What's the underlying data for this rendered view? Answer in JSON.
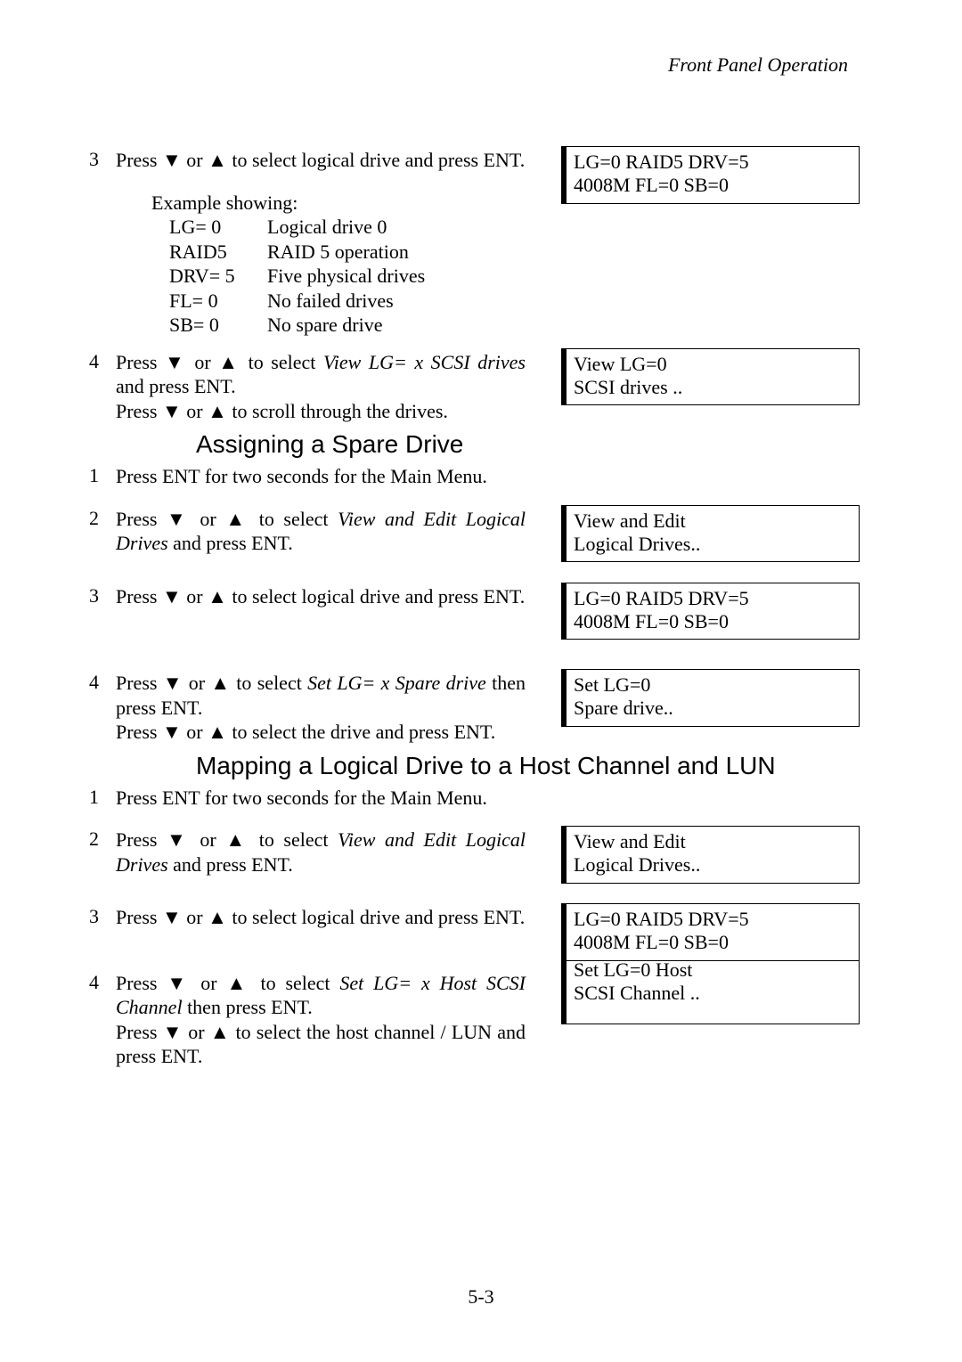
{
  "header": {
    "running": "Front Panel Operation"
  },
  "glyph": {
    "down": "▼",
    "up": "▲"
  },
  "sec1": {
    "step3": {
      "num": "3",
      "text_a": "Press ",
      "text_b": " or ",
      "text_c": " to select logical drive and press ENT.",
      "lcd": "LG=0 RAID5 DRV=5\n4008M FL=0 SB=0",
      "example_label": "Example showing:",
      "rows": [
        {
          "k": "LG= 0",
          "v": "Logical drive 0"
        },
        {
          "k": "RAID5",
          "v": "RAID 5 operation"
        },
        {
          "k": "DRV= 5",
          "v": "Five physical drives"
        },
        {
          "k": "FL= 0",
          "v": "No failed drives"
        },
        {
          "k": "SB= 0",
          "v": "No spare drive"
        }
      ]
    },
    "step4": {
      "num": "4",
      "text_a": "Press ",
      "text_b": " or ",
      "text_c": " to select ",
      "italic": "View LG= x SCSI drives",
      "text_d": " and press ENT.",
      "line2_a": "Press ",
      "line2_b": " or ",
      "line2_c": " to scroll through the drives.",
      "lcd": "View LG=0\nSCSI drives   .."
    }
  },
  "sec2": {
    "heading": "Assigning a Spare Drive",
    "step1": {
      "num": "1",
      "text": "Press ENT for two seconds for the Main Menu."
    },
    "step2": {
      "num": "2",
      "text_a": "Press ",
      "text_b": " or ",
      "text_c": " to select ",
      "italic": "View and Edit Logical Drives",
      "text_d": " and press ENT.",
      "lcd": "View and Edit\nLogical Drives.."
    },
    "step3": {
      "num": "3",
      "text_a": "Press ",
      "text_b": " or ",
      "text_c": " to select logical drive and press ENT.",
      "lcd": "LG=0 RAID5 DRV=5\n4008M FL=0 SB=0"
    },
    "step4": {
      "num": "4",
      "text_a": "Press ",
      "text_b": " or ",
      "text_c": " to select ",
      "italic": "Set LG= x Spare drive",
      "text_d": " then press ENT.",
      "line2_a": "Press ",
      "line2_b": " or ",
      "line2_c": " to select the drive and press ENT.",
      "lcd": "Set LG=0\nSpare drive.."
    }
  },
  "sec3": {
    "heading": "Mapping a Logical Drive to a Host Channel and  LUN",
    "step1": {
      "num": "1",
      "text": "Press ENT for two seconds for the Main Menu."
    },
    "step2": {
      "num": "2",
      "text_a": "Press ",
      "text_b": " or ",
      "text_c": " to select ",
      "italic": "View and Edit Logical Drives",
      "text_d": " and press ENT.",
      "lcd": "View and Edit\nLogical Drives.."
    },
    "step3": {
      "num": "3",
      "text_a": "Press ",
      "text_b": " or ",
      "text_c": " to select logical drive and press ENT.",
      "lcd": "LG=0 RAID5 DRV=5\n4008M FL=0 SB=0"
    },
    "step4": {
      "num": "4",
      "text_a": "Press ",
      "text_b": " or ",
      "text_c": " to select ",
      "italic": "Set LG= x Host SCSI Channel",
      "text_d": " then press ENT.",
      "line2_a": "Press ",
      "line2_b": " or ",
      "line2_c": " to select the host channel / LUN and press ENT.",
      "lcd": "Set LG=0 Host\nSCSI Channel    .."
    }
  },
  "footer": {
    "pagenum": "5-3"
  }
}
